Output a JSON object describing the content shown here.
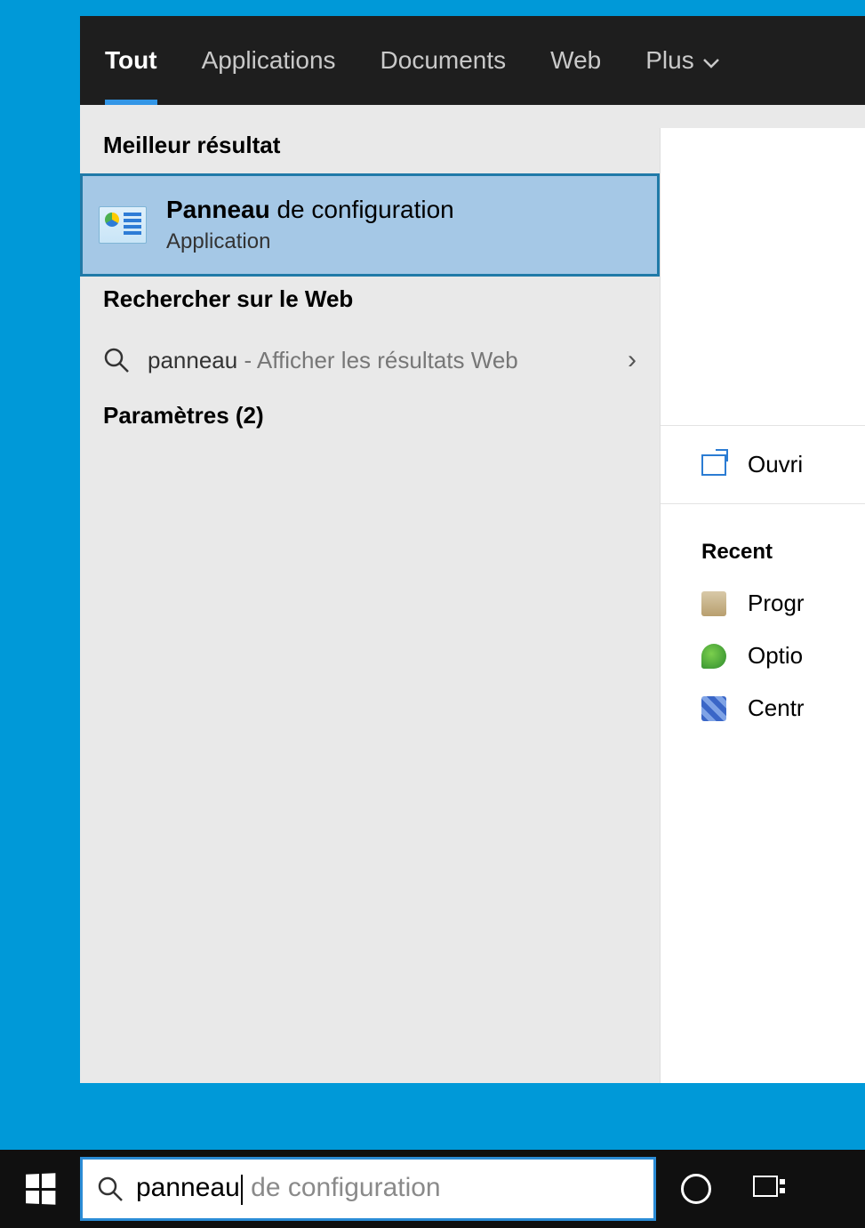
{
  "tabs": {
    "all": "Tout",
    "apps": "Applications",
    "docs": "Documents",
    "web": "Web",
    "more": "Plus"
  },
  "sections": {
    "best": "Meilleur résultat",
    "web": "Rechercher sur le Web",
    "settings": "Paramètres (2)"
  },
  "best_result": {
    "title_bold": "Panneau",
    "title_rest": " de configuration",
    "subtitle": "Application"
  },
  "web_result": {
    "query": "panneau",
    "suffix": " - Afficher les résultats Web"
  },
  "detail": {
    "open": "Ouvri",
    "recent_heading": "Recent",
    "recent": [
      "Progr",
      "Optio",
      "Centr"
    ]
  },
  "search": {
    "typed": "panneau",
    "hint": " de configuration"
  }
}
